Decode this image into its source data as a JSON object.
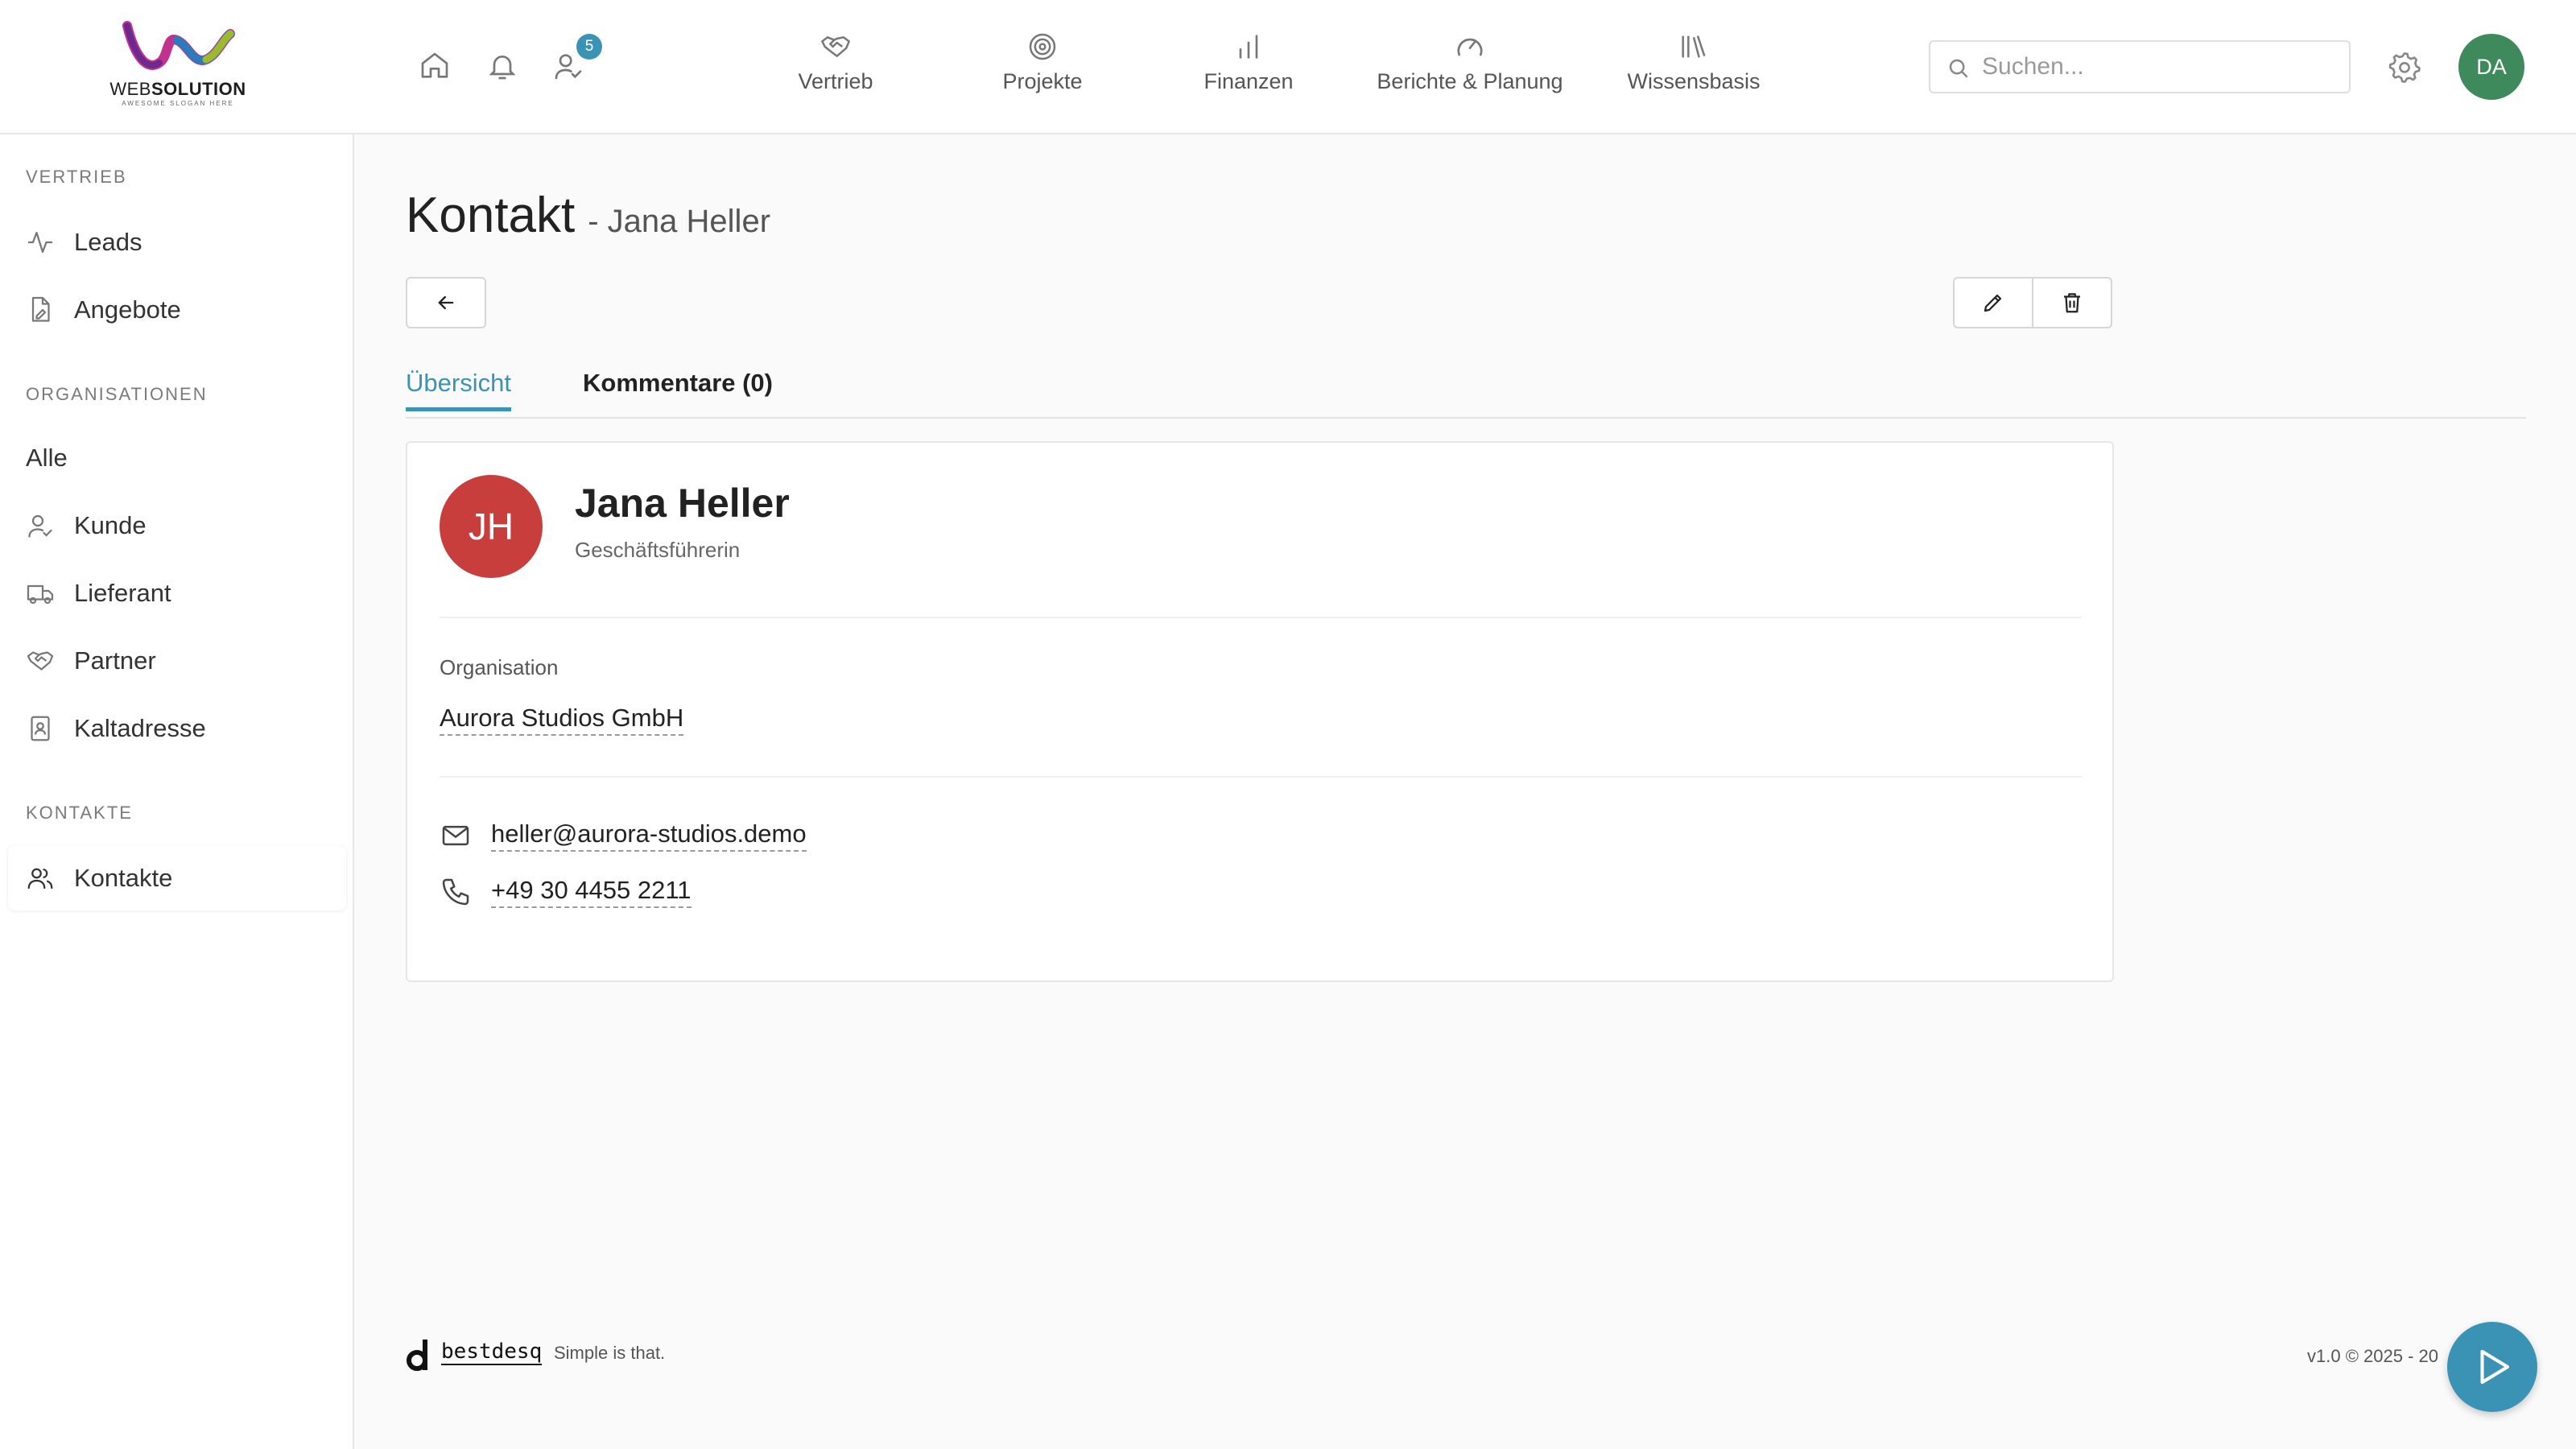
{
  "brand": {
    "logo_main": "WEB",
    "logo_bold": "SOLUTION",
    "logo_tagline": "AWESOME SLOGAN HERE",
    "colors": {
      "accent": "#3a93b5",
      "avatar_user": "#3f8a5c",
      "avatar_contact": "#c83e3d"
    }
  },
  "topbar": {
    "quick_icons": [
      "home-icon",
      "bell-icon",
      "user-check-icon"
    ],
    "notification_count": "5",
    "nav": [
      {
        "label": "Vertrieb",
        "icon": "handshake-icon"
      },
      {
        "label": "Projekte",
        "icon": "target-icon"
      },
      {
        "label": "Finanzen",
        "icon": "bar-chart-icon"
      },
      {
        "label": "Berichte & Planung",
        "icon": "gauge-icon"
      },
      {
        "label": "Wissensbasis",
        "icon": "library-icon"
      }
    ],
    "search_placeholder": "Suchen...",
    "user_initials": "DA"
  },
  "sidebar": {
    "sections": [
      {
        "title": "VERTRIEB",
        "items": [
          {
            "label": "Leads",
            "icon": "activity-icon"
          },
          {
            "label": "Angebote",
            "icon": "file-signature-icon"
          }
        ]
      },
      {
        "title": "ORGANISATIONEN",
        "items": [
          {
            "label": "Alle",
            "icon": ""
          },
          {
            "label": "Kunde",
            "icon": "user-check-icon"
          },
          {
            "label": "Lieferant",
            "icon": "truck-icon"
          },
          {
            "label": "Partner",
            "icon": "handshake-icon"
          },
          {
            "label": "Kaltadresse",
            "icon": "address-book-icon"
          }
        ]
      },
      {
        "title": "KONTAKTE",
        "items": [
          {
            "label": "Kontakte",
            "icon": "users-icon",
            "active": true
          }
        ]
      }
    ]
  },
  "page": {
    "title": "Kontakt",
    "subtitle": "- Jana Heller",
    "tabs": [
      {
        "label": "Übersicht",
        "active": true
      },
      {
        "label": "Kommentare (0)",
        "active": false
      }
    ]
  },
  "contact": {
    "initials": "JH",
    "name": "Jana Heller",
    "role": "Geschäftsführerin",
    "organisation_label": "Organisation",
    "organisation": "Aurora Studios GmbH",
    "email": "heller@aurora-studios.demo",
    "phone": "+49 30 4455 2211"
  },
  "footer": {
    "brand": "bestdesq",
    "tagline": "Simple is that.",
    "version": "v1.0 © 2025 - 20"
  }
}
